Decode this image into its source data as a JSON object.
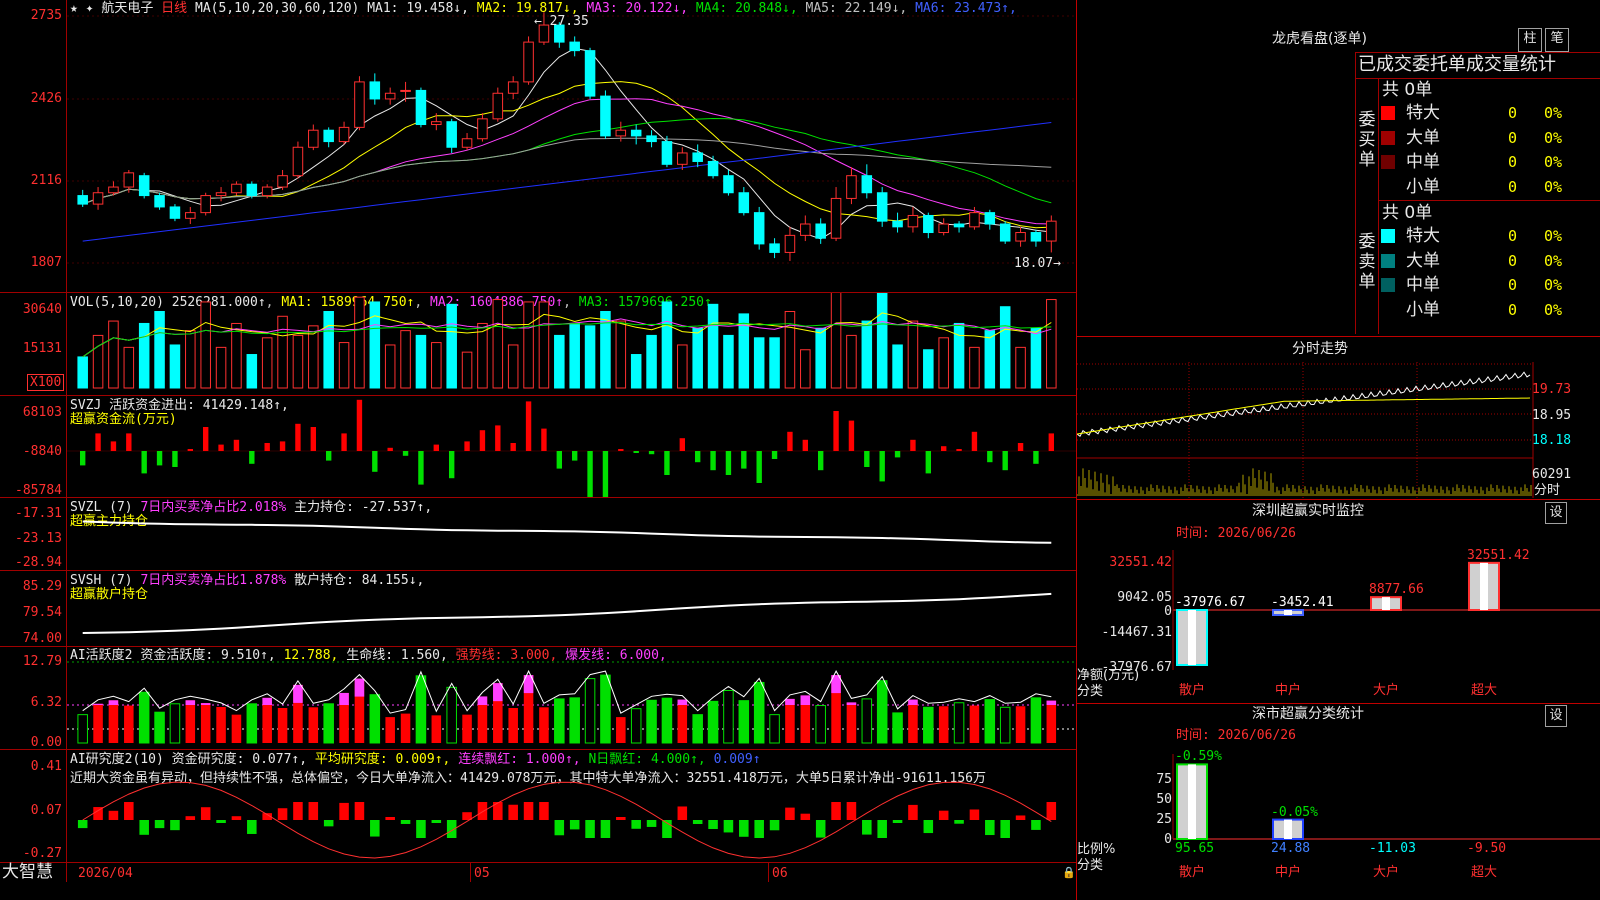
{
  "stock": {
    "name": "航天电子",
    "period": "日线",
    "ma_header": "MA(5,10,20,30,60,120)",
    "ma": [
      {
        "label": "MA1:",
        "value": "19.458↓",
        "color": "#e8e8e8"
      },
      {
        "label": "MA2:",
        "value": "19.817↓",
        "color": "#ffff00"
      },
      {
        "label": "MA3:",
        "value": "20.122↓",
        "color": "#ff40ff"
      },
      {
        "label": "MA4:",
        "value": "20.848↓",
        "color": "#00e000"
      },
      {
        "label": "MA5:",
        "value": "22.149↓",
        "color": "#c0c0c0"
      },
      {
        "label": "MA6:",
        "value": "23.473↑",
        "color": "#4060ff"
      }
    ],
    "high_mark": "27.35",
    "low_mark": "18.07→"
  },
  "price_axis": [
    "2735",
    "2426",
    "2116",
    "1807"
  ],
  "vol": {
    "header": "VOL(5,10,20)",
    "value": "2526281.000↑",
    "ma1": "MA1: 1589964.750↑",
    "ma2": "MA2: 1604886.750↑",
    "ma3": "MA3: 1579696.250↑",
    "axis": [
      "30640",
      "15131"
    ],
    "unit": "X100"
  },
  "svzj": {
    "header": "SVZJ",
    "label": "活跃资金进出: 41429.148↑,",
    "sublabel": "超赢资金流(万元)",
    "axis": [
      "68103",
      "-8840",
      "-85784"
    ]
  },
  "svzl": {
    "header": "SVZL (7)",
    "label1": "7日内买卖净占比2.018%",
    "label2": "主力持仓: -27.537↑,",
    "sublabel": "超赢主力持仓",
    "axis": [
      "-17.31",
      "-23.13",
      "-28.94"
    ]
  },
  "svsh": {
    "header": "SVSH (7)",
    "label1": "7日内买卖净占比1.878%",
    "label2": "散户持仓: 84.155↓,",
    "sublabel": "超赢散户持仓",
    "axis": [
      "85.29",
      "79.54",
      "74.00"
    ]
  },
  "ai_active": {
    "header": "AI活跃度2",
    "label1": "资金活跃度: 9.510↑,",
    "label2": "12.788,",
    "label3": "生命线: 1.560,",
    "label4": "强势线: 3.000,",
    "label5": "爆发线: 6.000,",
    "axis": [
      "12.79",
      "6.32",
      "0.00"
    ]
  },
  "ai_research": {
    "header": "AI研究度2(10)",
    "label1": "资金研究度: 0.077↑,",
    "label2": "平均研究度: 0.009↑,",
    "label3": "连续飘红: 1.000↑,",
    "label4": "N日飘红: 4.000↑,",
    "label5": "0.009↑",
    "comment": "近期大资金虽有异动，但持续性不强，总体偏空，今日大单净流入：41429.078万元，其中特大单净流入：32551.418万元，大单5日累计净出-91611.156万",
    "axis": [
      "0.41",
      "0.07",
      "-0.27"
    ]
  },
  "bottom_bar": {
    "brand": "大智慧",
    "date": "2026/04",
    "m05": "05",
    "m06": "06"
  },
  "right_panel": {
    "title": "龙虎看盘(逐单)",
    "tab1": "柱",
    "tab2": "笔",
    "subtitle": "已成交委托单成交量统计",
    "buy": {
      "side": "委买单",
      "total": "共 0单",
      "rows": [
        {
          "label": "特大",
          "count": "0",
          "pct": "0%",
          "color": "#ff0000"
        },
        {
          "label": "大单",
          "count": "0",
          "pct": "0%",
          "color": "#a00000"
        },
        {
          "label": "中单",
          "count": "0",
          "pct": "0%",
          "color": "#700000"
        },
        {
          "label": "小单",
          "count": "0",
          "pct": "0%",
          "color": "#000000"
        }
      ]
    },
    "sell": {
      "side": "委卖单",
      "total": "共 0单",
      "rows": [
        {
          "label": "特大",
          "count": "0",
          "pct": "0%",
          "color": "#00ffff"
        },
        {
          "label": "大单",
          "count": "0",
          "pct": "0%",
          "color": "#008080"
        },
        {
          "label": "中单",
          "count": "0",
          "pct": "0%",
          "color": "#006060"
        },
        {
          "label": "小单",
          "count": "0",
          "pct": "0%",
          "color": "#000000"
        }
      ]
    },
    "intraday": {
      "title": "分时走势",
      "axis": [
        "19.73",
        "18.95",
        "18.18"
      ],
      "vol_axis": "60291",
      "vol_unit": "分时"
    },
    "sz_monitor": {
      "title": "深圳超赢实时监控",
      "setting": "设",
      "time": "时间: 2026/06/26",
      "axis": [
        "32551.42",
        "9042.05",
        "0",
        "-14467.31",
        "-37976.67"
      ],
      "unit1": "净额(万元)",
      "unit2": "分类",
      "bars": [
        {
          "label": "散户",
          "value": "-37976.67"
        },
        {
          "label": "中户",
          "value": "-3452.41"
        },
        {
          "label": "大户",
          "value": "8877.66"
        },
        {
          "label": "超大",
          "value": "32551.42"
        }
      ]
    },
    "sz_class": {
      "title": "深市超赢分类统计",
      "setting": "设",
      "time": "时间: 2026/06/26",
      "axis": [
        "75",
        "50",
        "25",
        "0"
      ],
      "unit1": "比例%",
      "unit2": "分类",
      "bars": [
        {
          "label": "散户",
          "value": "95.65",
          "change": "-0.59%"
        },
        {
          "label": "中户",
          "value": "24.88",
          "change": "-0.05%"
        },
        {
          "label": "大户",
          "value": "-11.03",
          "change": ""
        },
        {
          "label": "超大",
          "value": "-9.50",
          "change": ""
        }
      ]
    }
  },
  "chart_data": [
    {
      "type": "candlestick",
      "title": "航天电子 日线",
      "ylim": [
        18.0,
        27.5
      ],
      "candles": [
        [
          20.9,
          20.6,
          21.1,
          20.5
        ],
        [
          20.6,
          21.0,
          21.2,
          20.4
        ],
        [
          21.0,
          21.2,
          21.4,
          20.9
        ],
        [
          21.2,
          21.7,
          21.8,
          21.0
        ],
        [
          21.6,
          20.9,
          21.7,
          20.8
        ],
        [
          20.9,
          20.5,
          21.0,
          20.4
        ],
        [
          20.5,
          20.1,
          20.6,
          20.0
        ],
        [
          20.1,
          20.3,
          20.5,
          19.9
        ],
        [
          20.3,
          20.9,
          21.0,
          20.2
        ],
        [
          20.9,
          21.0,
          21.2,
          20.7
        ],
        [
          21.0,
          21.3,
          21.4,
          20.9
        ],
        [
          21.3,
          20.9,
          21.4,
          20.8
        ],
        [
          20.9,
          21.2,
          21.3,
          20.8
        ],
        [
          21.2,
          21.6,
          21.8,
          21.1
        ],
        [
          21.6,
          22.6,
          22.8,
          21.5
        ],
        [
          22.6,
          23.2,
          23.4,
          22.5
        ],
        [
          23.2,
          22.8,
          23.3,
          22.6
        ],
        [
          22.8,
          23.3,
          23.5,
          22.7
        ],
        [
          23.3,
          24.9,
          25.1,
          23.2
        ],
        [
          24.9,
          24.3,
          25.2,
          24.1
        ],
        [
          24.3,
          24.5,
          24.7,
          24.1
        ],
        [
          24.6,
          24.6,
          24.9,
          24.2
        ],
        [
          24.6,
          23.4,
          24.7,
          23.3
        ],
        [
          23.4,
          23.5,
          23.8,
          23.2
        ],
        [
          23.5,
          22.6,
          23.6,
          22.4
        ],
        [
          22.6,
          22.9,
          23.1,
          22.5
        ],
        [
          22.9,
          23.6,
          23.8,
          22.8
        ],
        [
          23.6,
          24.5,
          24.7,
          23.5
        ],
        [
          24.5,
          24.9,
          25.1,
          24.3
        ],
        [
          24.9,
          26.3,
          26.5,
          24.8
        ],
        [
          26.3,
          26.9,
          27.35,
          26.2
        ],
        [
          26.9,
          26.3,
          27.0,
          26.1
        ],
        [
          26.3,
          26.0,
          26.5,
          25.8
        ],
        [
          26.0,
          24.4,
          26.1,
          24.3
        ],
        [
          24.4,
          23.0,
          24.6,
          22.9
        ],
        [
          23.0,
          23.2,
          23.5,
          22.8
        ],
        [
          23.2,
          23.0,
          23.4,
          22.7
        ],
        [
          23.0,
          22.8,
          23.2,
          22.6
        ],
        [
          22.8,
          22.0,
          23.0,
          21.9
        ],
        [
          22.0,
          22.4,
          22.6,
          21.8
        ],
        [
          22.4,
          22.1,
          22.7,
          21.9
        ],
        [
          22.1,
          21.6,
          22.3,
          21.5
        ],
        [
          21.6,
          21.0,
          21.8,
          20.9
        ],
        [
          21.0,
          20.3,
          21.2,
          20.2
        ],
        [
          20.3,
          19.2,
          20.5,
          19.0
        ],
        [
          19.2,
          18.9,
          19.4,
          18.7
        ],
        [
          18.9,
          19.5,
          19.8,
          18.6
        ],
        [
          19.5,
          19.9,
          20.2,
          19.3
        ],
        [
          19.9,
          19.4,
          20.1,
          19.2
        ],
        [
          19.4,
          20.8,
          21.2,
          19.3
        ],
        [
          20.8,
          21.6,
          21.9,
          20.6
        ],
        [
          21.6,
          21.0,
          22.0,
          20.8
        ],
        [
          21.0,
          20.0,
          21.2,
          19.8
        ],
        [
          20.0,
          19.8,
          20.3,
          19.6
        ],
        [
          19.8,
          20.2,
          20.5,
          19.6
        ],
        [
          20.2,
          19.6,
          20.3,
          19.4
        ],
        [
          19.6,
          19.9,
          20.1,
          19.5
        ],
        [
          19.9,
          19.8,
          20.0,
          19.6
        ],
        [
          19.8,
          20.3,
          20.5,
          19.7
        ],
        [
          20.3,
          19.9,
          20.4,
          19.7
        ],
        [
          19.9,
          19.3,
          20.0,
          19.2
        ],
        [
          19.3,
          19.6,
          19.8,
          19.1
        ],
        [
          19.6,
          19.3,
          19.7,
          19.1
        ],
        [
          19.3,
          20.0,
          20.2,
          18.9
        ]
      ]
    }
  ]
}
